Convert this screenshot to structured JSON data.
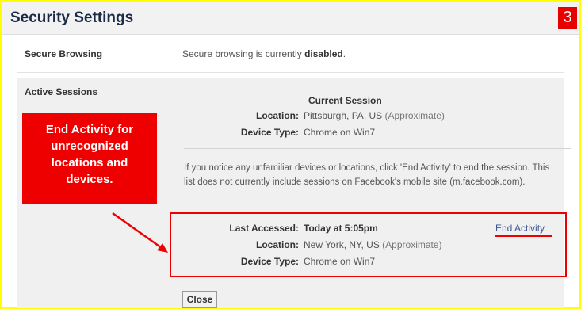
{
  "title": "Security Settings",
  "step_badge": "3",
  "secure_browsing": {
    "label": "Secure Browsing",
    "text_prefix": "Secure browsing is currently",
    "status": "disabled",
    "text_suffix": "."
  },
  "active_sessions": {
    "label": "Active Sessions",
    "current_session": {
      "heading": "Current Session",
      "location_label": "Location:",
      "location_value": "Pittsburgh, PA, US",
      "location_note": "(Approximate)",
      "device_label": "Device Type:",
      "device_value": "Chrome on Win7"
    },
    "notice": "If you notice any unfamiliar devices or locations, click 'End Activity' to end the session. This list does not currently include sessions on Facebook's mobile site (m.facebook.com).",
    "other_session": {
      "last_accessed_label": "Last Accessed:",
      "last_accessed_value": "Today at 5:05pm",
      "location_label": "Location:",
      "location_value": "New York, NY, US",
      "location_note": "(Approximate)",
      "device_label": "Device Type:",
      "device_value": "Chrome on Win7",
      "end_activity_label": "End Activity"
    }
  },
  "callout": {
    "line1": "End Activity for",
    "line2": "unrecognized",
    "line3": "locations and",
    "line4": "devices."
  },
  "buttons": {
    "close_label": "Close"
  },
  "colors": {
    "frame": "#ffff00",
    "annotation_red": "#ee0000",
    "link": "#3b5998",
    "title": "#1c2a47"
  }
}
